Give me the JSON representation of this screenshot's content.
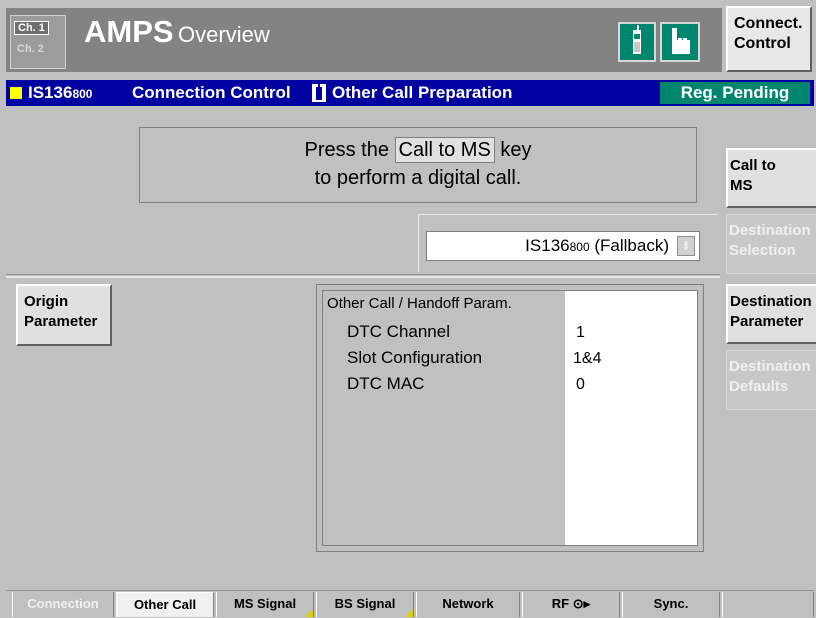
{
  "header": {
    "channel1_label": "Ch. 1",
    "channel2_label": "Ch. 2",
    "title_main": "AMPS",
    "title_sub": "Overview",
    "connect_button": "Connect.\nControl",
    "icons": [
      "mobile-phone-icon",
      "hand-pointer-icon"
    ]
  },
  "context_bar": {
    "standard": "IS136",
    "band": "800",
    "section": "Connection Control",
    "subsection": "Other Call Preparation",
    "status": "Reg. Pending"
  },
  "hint": {
    "line1_prefix": "Press the",
    "key": "Call to MS",
    "line1_suffix": "key",
    "line2": "to perform a digital call."
  },
  "destination_select": {
    "value_prefix": "IS136",
    "value_band": "800",
    "value_suffix": "(Fallback)"
  },
  "origin_button": "Origin\nParameter",
  "params": {
    "title": "Other Call / Handoff Param.",
    "rows": [
      {
        "label": "DTC Channel",
        "value": "1"
      },
      {
        "label": "Slot Configuration",
        "value": "1&4"
      },
      {
        "label": "DTC MAC",
        "value": "0"
      }
    ]
  },
  "softkeys": [
    {
      "label": "Call to\nMS",
      "enabled": true
    },
    {
      "label": "Destination\nSelection",
      "enabled": false
    },
    {
      "label": "Destination\nParameter",
      "enabled": true
    },
    {
      "label": "Destination\nDefaults",
      "enabled": false
    }
  ],
  "tabs": [
    {
      "label": "Connection",
      "state": "disabled"
    },
    {
      "label": "Other Call",
      "state": "selected"
    },
    {
      "label": "MS Signal",
      "state": "normal"
    },
    {
      "label": "BS Signal",
      "state": "normal"
    },
    {
      "label": "Network",
      "state": "normal"
    },
    {
      "label": "RF",
      "state": "normal"
    },
    {
      "label": "Sync.",
      "state": "normal"
    }
  ],
  "colors": {
    "context_bar": "#0000a0",
    "status_badge": "#00856f",
    "panel_gray": "#c0c0c0"
  }
}
